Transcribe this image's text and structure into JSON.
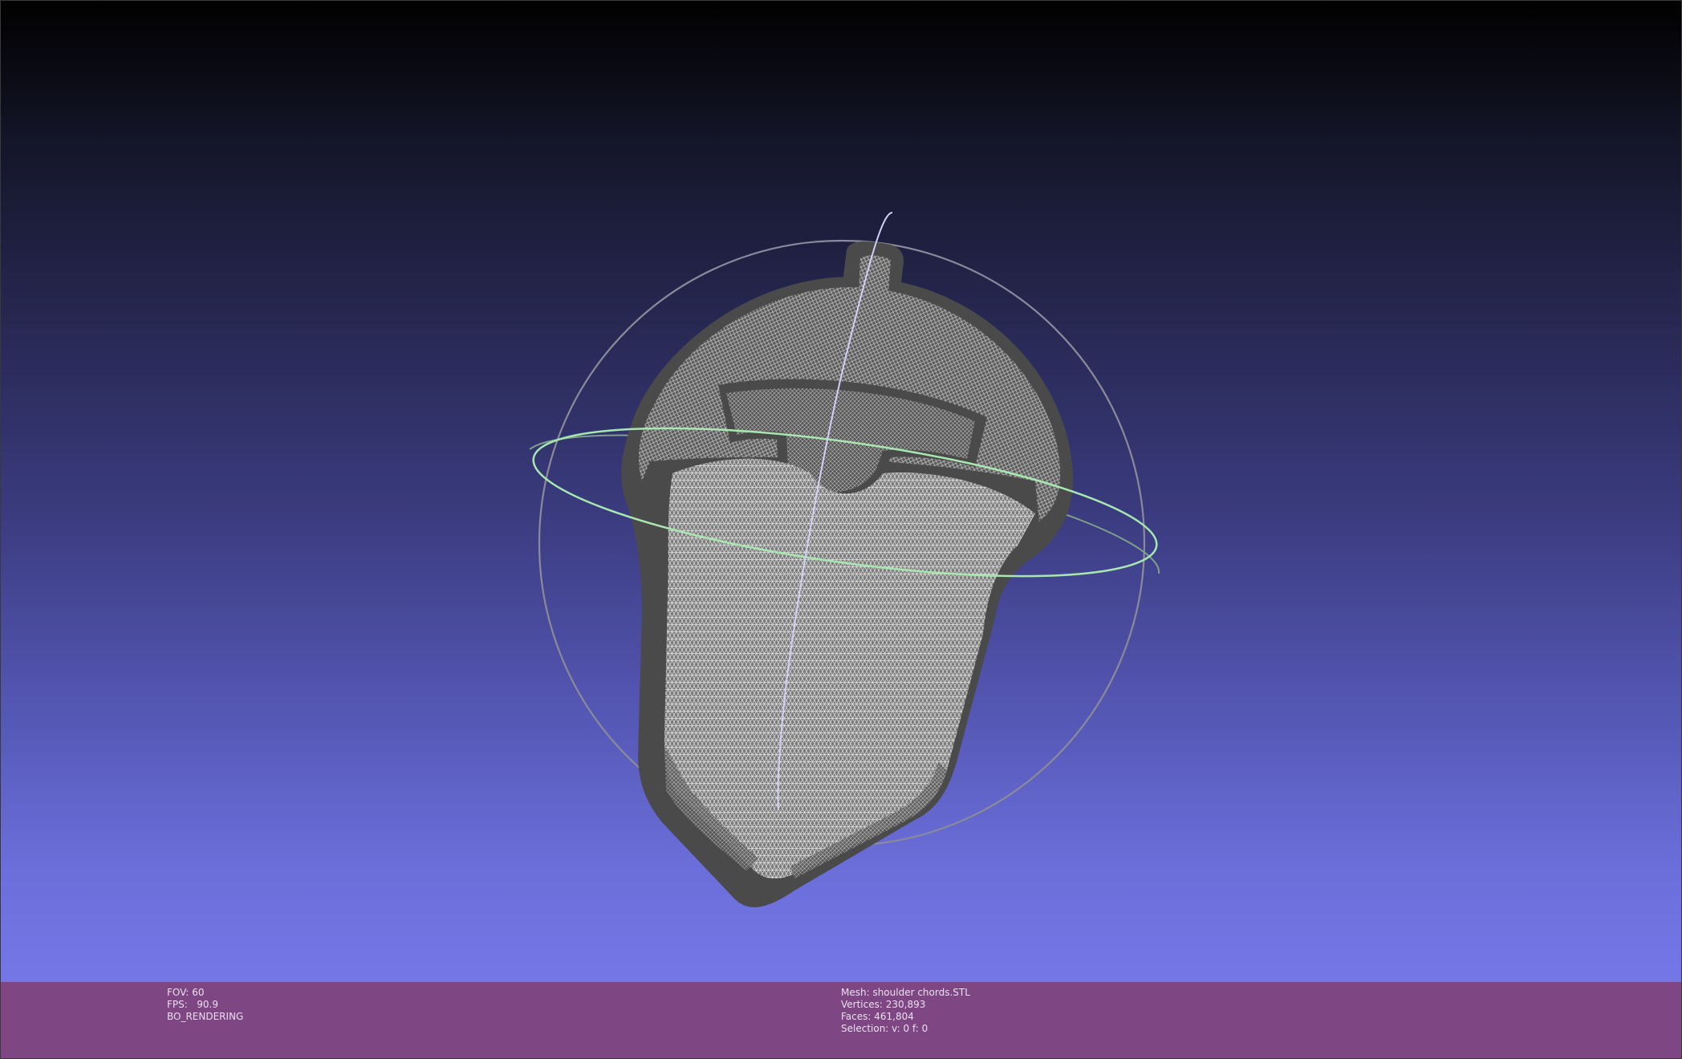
{
  "app": {
    "viewport_label": "3D mesh viewport"
  },
  "info_left": {
    "fov": "FOV: 60",
    "fps": "FPS:   90.9",
    "render_mode": "BO_RENDERING"
  },
  "info_right": {
    "mesh": "Mesh: shoulder chords.STL",
    "vertices": "Vertices: 230,893",
    "faces": "Faces: 461,804",
    "selection": "Selection: v: 0 f: 0"
  },
  "colors": {
    "background_top": "#000000",
    "background_bottom": "#7477e6",
    "info_bar": "#7f4684",
    "mesh_solid": "#4a4a4a",
    "mesh_wire": "#bdbdbd",
    "trackball_green": "#a8e8b0",
    "trackball_gray": "#8a8a9a",
    "trackball_blue": "#c8c8f0"
  }
}
